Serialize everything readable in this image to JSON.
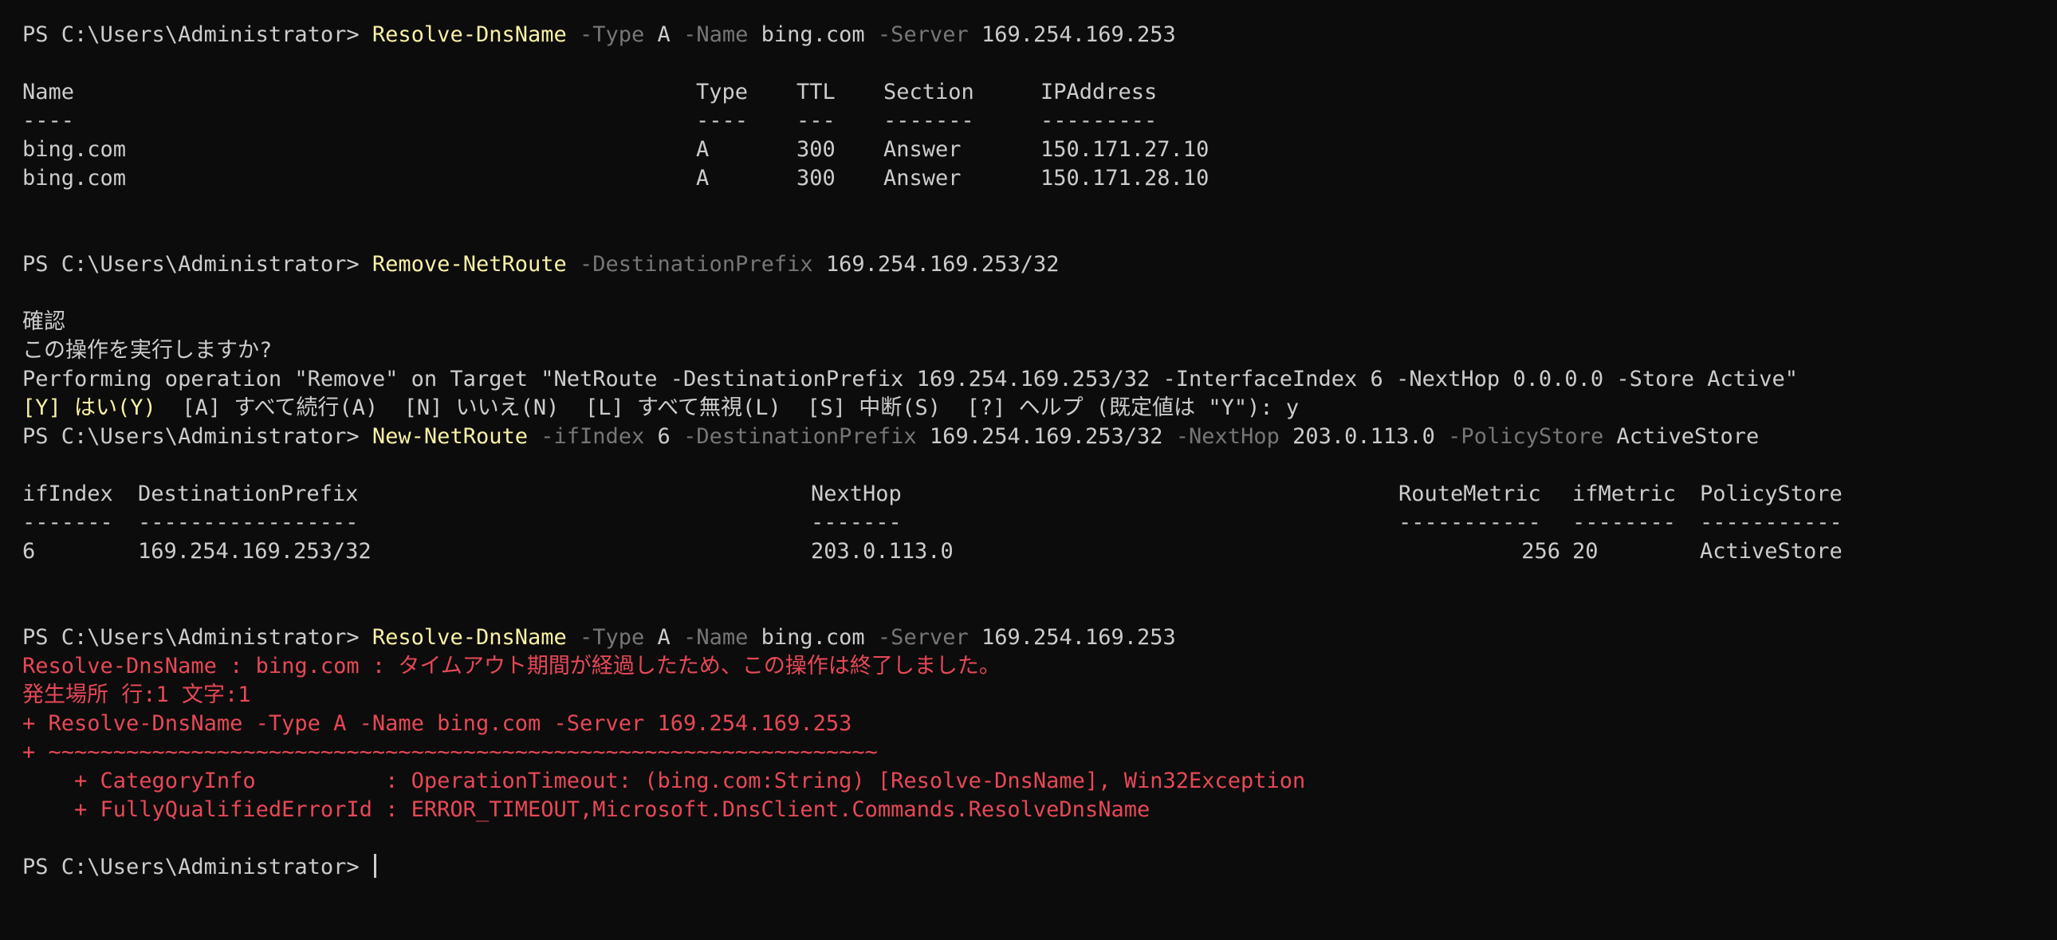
{
  "terminal": {
    "prompt": "PS C:\\Users\\Administrator> ",
    "cmd1": {
      "name": "Resolve-DnsName",
      "p1": " -Type",
      "v1": " A",
      "p2": " -Name",
      "v2": " bing.com",
      "p3": " -Server",
      "v3": " 169.254.169.253"
    },
    "dns_table": {
      "headers": [
        "Name",
        "Type",
        "TTL",
        "Section",
        "IPAddress"
      ],
      "underlines": [
        "----",
        "----",
        "---",
        "-------",
        "---------"
      ],
      "rows": [
        [
          "bing.com",
          "A",
          "300",
          "Answer",
          "150.171.27.10"
        ],
        [
          "bing.com",
          "A",
          "300",
          "Answer",
          "150.171.28.10"
        ]
      ]
    },
    "cmd2": {
      "name": "Remove-NetRoute",
      "p1": " -DestinationPrefix",
      "v1": " 169.254.169.253/32"
    },
    "confirm": {
      "title": "確認",
      "question": "この操作を実行しますか?",
      "operation": "Performing operation \"Remove\" on Target \"NetRoute -DestinationPrefix 169.254.169.253/32 -InterfaceIndex 6 -NextHop 0.0.0.0 -Store Active\"",
      "options_highlight": "[Y] はい(Y)",
      "options_rest": "  [A] すべて続行(A)  [N] いいえ(N)  [L] すべて無視(L)  [S] 中断(S)  [?] ヘルプ (既定値は \"Y\"): ",
      "answer": "y"
    },
    "cmd3": {
      "name": "New-NetRoute",
      "p1": " -ifIndex",
      "v1": " 6",
      "p2": " -DestinationPrefix",
      "v2": " 169.254.169.253/32",
      "p3": " -NextHop",
      "v3": " 203.0.113.0",
      "p4": " -PolicyStore",
      "v4": " ActiveStore"
    },
    "route_table": {
      "headers": [
        "ifIndex",
        "DestinationPrefix",
        "NextHop",
        "RouteMetric",
        "ifMetric",
        "PolicyStore"
      ],
      "underlines": [
        "-------",
        "-----------------",
        "-------",
        "-----------",
        "--------",
        "-----------"
      ],
      "row": [
        "6",
        "169.254.169.253/32",
        "203.0.113.0",
        "256",
        "20",
        "ActiveStore"
      ]
    },
    "cmd4": {
      "name": "Resolve-DnsName",
      "p1": " -Type",
      "v1": " A",
      "p2": " -Name",
      "v2": " bing.com",
      "p3": " -Server",
      "v3": " 169.254.169.253"
    },
    "error": {
      "line1": "Resolve-DnsName : bing.com : タイムアウト期間が経過したため、この操作は終了しました。",
      "line2": "発生場所 行:1 文字:1",
      "line3": "+ Resolve-DnsName -Type A -Name bing.com -Server 169.254.169.253",
      "line4": "+ ~~~~~~~~~~~~~~~~~~~~~~~~~~~~~~~~~~~~~~~~~~~~~~~~~~~~~~~~~~~~~~~~",
      "line5": "    + CategoryInfo          : OperationTimeout: (bing.com:String) [Resolve-DnsName], Win32Exception",
      "line6": "    + FullyQualifiedErrorId : ERROR_TIMEOUT,Microsoft.DnsClient.Commands.ResolveDnsName"
    }
  }
}
